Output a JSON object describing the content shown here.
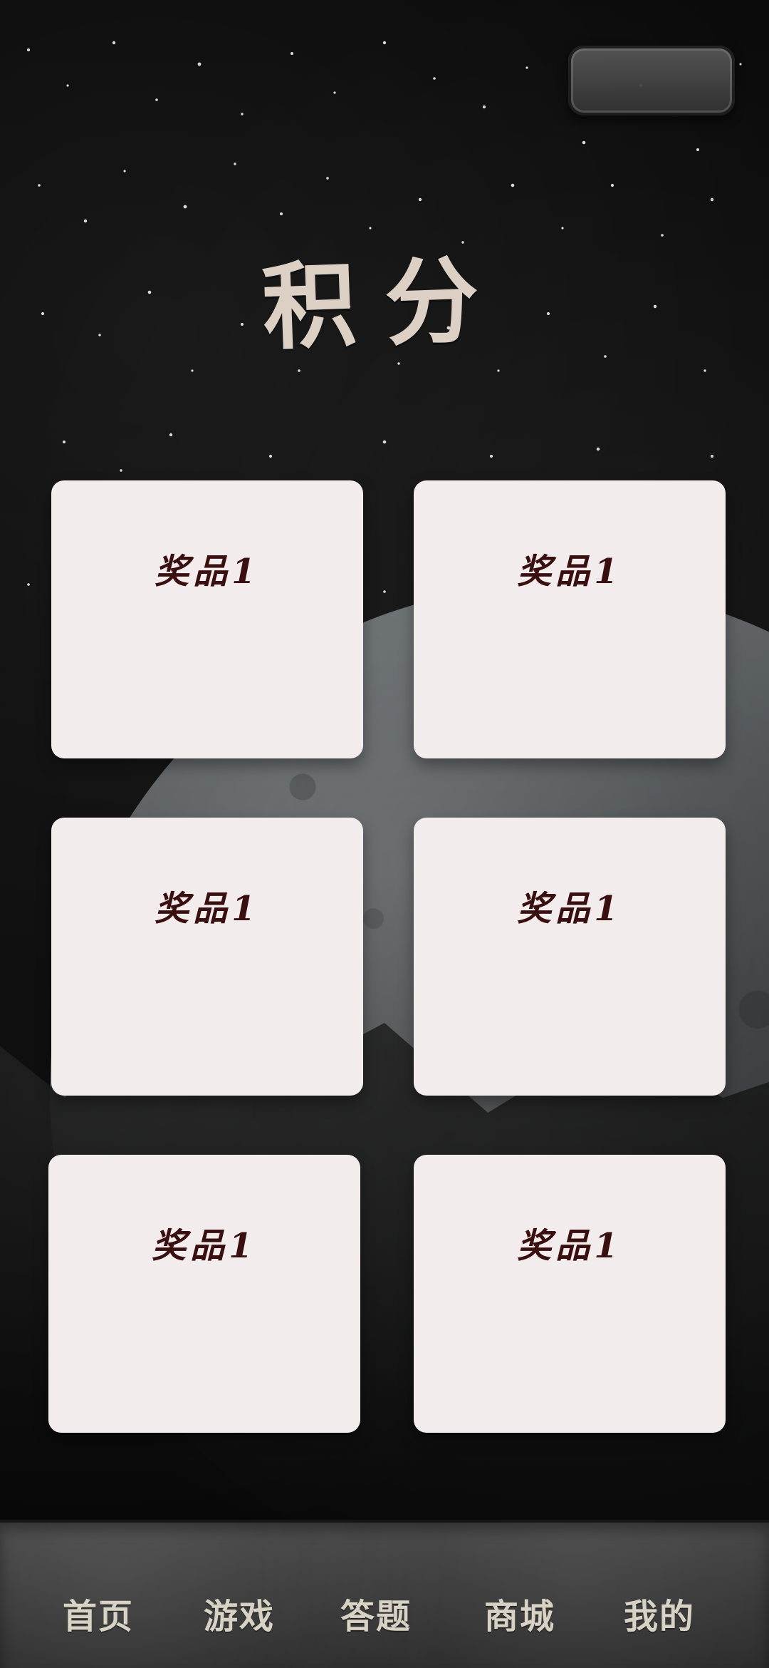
{
  "page": {
    "title": "积分"
  },
  "top_control": {
    "label": ""
  },
  "rewards": {
    "cards": [
      {
        "label": "奖品1"
      },
      {
        "label": "奖品1"
      },
      {
        "label": "奖品1"
      },
      {
        "label": "奖品1"
      },
      {
        "label": "奖品1"
      },
      {
        "label": "奖品1"
      }
    ]
  },
  "bottom_nav": {
    "items": [
      {
        "label": "首页"
      },
      {
        "label": "游戏"
      },
      {
        "label": "答题"
      },
      {
        "label": "商城"
      },
      {
        "label": "我的"
      }
    ]
  },
  "colors": {
    "title": "#dccfc4",
    "card_bg": "#f2ecec",
    "card_text": "#3a0f0f",
    "nav_text": "#d8d2c4"
  },
  "icons": {
    "top_control": "pill-button"
  }
}
